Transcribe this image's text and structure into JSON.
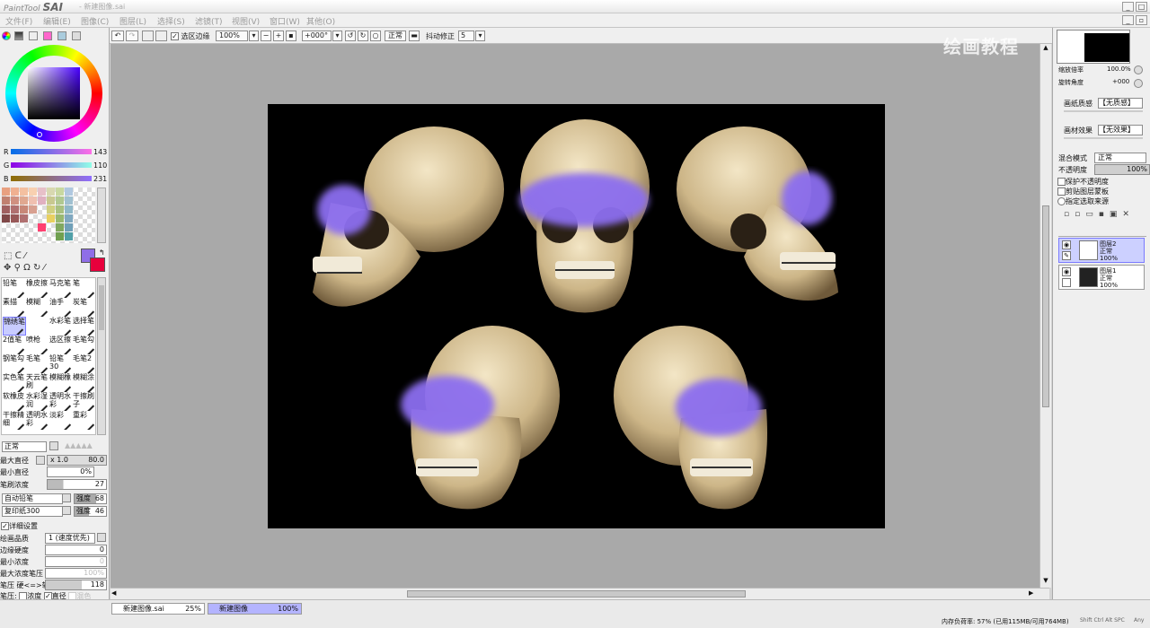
{
  "app": {
    "logo_small": "PaintTool",
    "logo": "SAI",
    "window_title": "- 新建图像.sai"
  },
  "menu": [
    "文件(F)",
    "编辑(E)",
    "图像(C)",
    "图层(L)",
    "选择(S)",
    "滤镜(T)",
    "视图(V)",
    "窗口(W)",
    "其他(O)"
  ],
  "toolbar": {
    "sel_edge_label": "选区边缘",
    "zoom": "100%",
    "angle": "+000°",
    "blend": "正常",
    "stabilizer_label": "抖动修正",
    "stabilizer_value": "5"
  },
  "watermark": "绘画教程",
  "color": {
    "r_label": "R",
    "r": "143",
    "g_label": "G",
    "g": "110",
    "b_label": "B",
    "b": "231",
    "primary": "#8F6EE7",
    "secondary": "#E8003C"
  },
  "tools": [
    [
      "铅笔",
      "橡皮擦",
      "马克笔",
      "笔"
    ],
    [
      "素描",
      "模糊",
      "油手",
      "炭笔"
    ],
    [
      "锦绣笔",
      "",
      "水彩笔",
      "选择笔"
    ],
    [
      "2值笔",
      "喷枪",
      "选区擦",
      "毛笔勾"
    ],
    [
      "钢笔勾",
      "毛笔",
      "铅笔30",
      "毛笔2"
    ],
    [
      "实色笔",
      "天云笔刷",
      "模糊橡",
      "模糊涂"
    ],
    [
      "软橡皮",
      "水彩湿润",
      "透明水彩",
      "干擦刷子"
    ],
    [
      "干擦精细",
      "透明水彩",
      "淡彩",
      "重彩"
    ]
  ],
  "brush": {
    "blend": "正常",
    "max_size_label": "最大直径",
    "max_size_mult": "x 1.0",
    "max_size": "80.0",
    "min_size_label": "最小直径",
    "min_size": "0%",
    "density_label": "笔刷浓度",
    "density": "27",
    "shape1": "自动铅笔",
    "shape1_label": "强度",
    "shape1_val": "68",
    "shape2": "复印纸300",
    "shape2_label": "强度",
    "shape2_val": "46",
    "detail_label": "详细设置",
    "quality_label": "绘画品质",
    "quality": "1 (速度优先)",
    "edge_label": "边缘硬度",
    "edge": "0",
    "min_density_label": "最小浓度",
    "min_density": "0",
    "max_density_pressure_label": "最大浓度笔压",
    "max_density_pressure": "100%",
    "pressure_label": "笔压 硬<=>软",
    "pressure": "118",
    "pressure2_label": "笔压:",
    "pressure_density": "浓度",
    "pressure_size": "直径",
    "pressure_blend": "混色"
  },
  "navigator": {
    "zoom_label": "缩放倍率",
    "zoom": "100.0%",
    "angle_label": "旋转角度",
    "angle": "+000"
  },
  "layers_panel": {
    "paper_tex_label": "画纸质感",
    "paper_tex": "【无质感】",
    "paper_fx_label": "画材效果",
    "paper_fx": "【无效果】",
    "blend_label": "混合模式",
    "blend": "正常",
    "opacity_label": "不透明度",
    "opacity": "100%",
    "opt1": "保护不透明度",
    "opt2": "剪贴图层蒙板",
    "opt3": "指定选取来源",
    "layers": [
      {
        "name": "图层2",
        "mode": "正常",
        "opacity": "100%"
      },
      {
        "name": "图层1",
        "mode": "正常",
        "opacity": "100%"
      }
    ]
  },
  "docs": [
    {
      "name": "新建图像.sai",
      "zoom": "25%"
    },
    {
      "name": "新建图像",
      "zoom": "100%"
    }
  ],
  "status": {
    "memory": "内存负荷率: 57% (已用115MB/可用764MB)",
    "keys": "Shift Ctrl Alt SPC",
    "any": "Any"
  }
}
